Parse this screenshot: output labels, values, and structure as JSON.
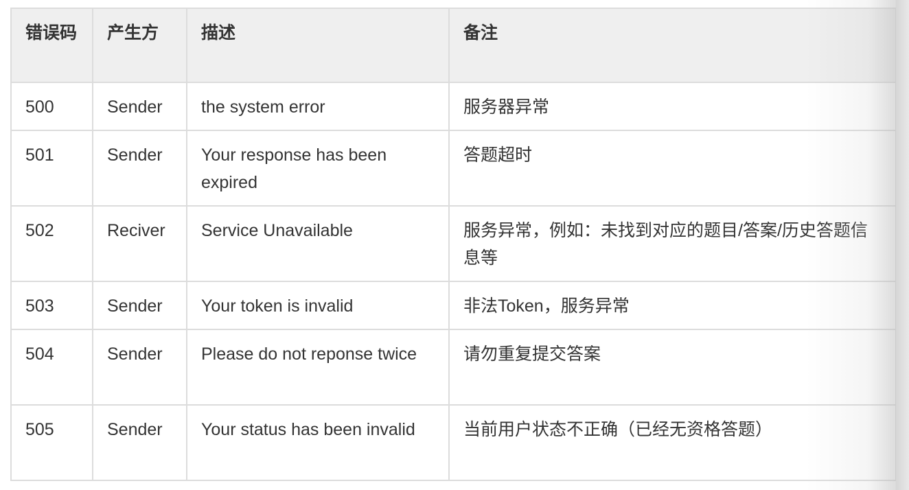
{
  "table": {
    "headers": [
      "错误码",
      "产生方",
      "描述",
      "备注"
    ],
    "rows": [
      {
        "code": "500",
        "source": "Sender",
        "description": "the system error",
        "note": "服务器异常"
      },
      {
        "code": "501",
        "source": "Sender",
        "description": "Your response has been expired",
        "note": "答题超时"
      },
      {
        "code": "502",
        "source": "Reciver",
        "description": "Service Unavailable",
        "note": "服务异常，例如：未找到对应的题目/答案/历史答题信息等"
      },
      {
        "code": "503",
        "source": "Sender",
        "description": "Your token is invalid",
        "note": "非法Token，服务异常"
      },
      {
        "code": "504",
        "source": "Sender",
        "description": "Please do not reponse twice",
        "note": "请勿重复提交答案"
      },
      {
        "code": "505",
        "source": "Sender",
        "description": "Your status has been invalid",
        "note": "当前用户状态不正确（已经无资格答题）"
      }
    ]
  }
}
